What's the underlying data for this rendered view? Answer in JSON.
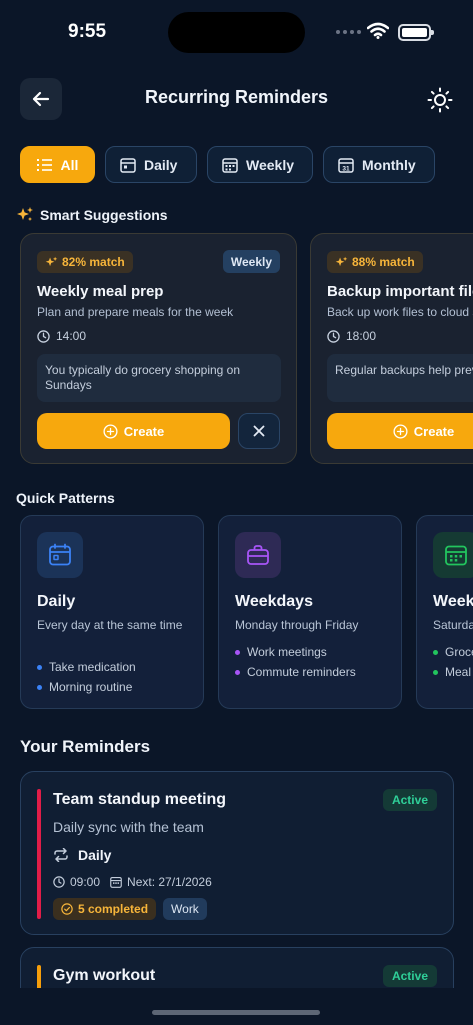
{
  "status_bar": {
    "time": "9:55"
  },
  "header": {
    "title": "Recurring Reminders",
    "back_icon": "arrow-left-icon",
    "theme_icon": "sun-icon"
  },
  "filters": [
    {
      "label": "All",
      "icon": "list-icon",
      "active": true
    },
    {
      "label": "Daily",
      "icon": "calendar-icon",
      "active": false
    },
    {
      "label": "Weekly",
      "icon": "calendar-grid-icon",
      "active": false
    },
    {
      "label": "Monthly",
      "icon": "calendar-31-icon",
      "active": false
    }
  ],
  "suggestions": {
    "heading": "Smart Suggestions",
    "items": [
      {
        "match": "82% match",
        "frequency": "Weekly",
        "title": "Weekly meal prep",
        "description": "Plan and prepare meals for the week",
        "time": "14:00",
        "reason": "You typically do grocery shopping on Sundays",
        "create_label": "Create"
      },
      {
        "match": "88% match",
        "frequency": "",
        "title": "Backup important files",
        "description": "Back up work files to cloud storage",
        "time": "18:00",
        "reason": "Regular backups help prevent data loss",
        "create_label": "Create"
      }
    ]
  },
  "patterns": {
    "heading": "Quick Patterns",
    "items": [
      {
        "title": "Daily",
        "description": "Every day at the same time",
        "examples": [
          "Take medication",
          "Morning routine"
        ],
        "color": "#3b82f6"
      },
      {
        "title": "Weekdays",
        "description": "Monday through Friday",
        "examples": [
          "Work meetings",
          "Commute reminders"
        ],
        "color": "#a855f7"
      },
      {
        "title": "Weekends",
        "description": "Saturday and Sunday",
        "examples": [
          "Grocery shopping",
          "Meal prep"
        ],
        "color": "#22c55e"
      }
    ]
  },
  "reminders": {
    "heading": "Your Reminders",
    "items": [
      {
        "title": "Team standup meeting",
        "status": "Active",
        "description": "Daily sync with the team",
        "frequency": "Daily",
        "time": "09:00",
        "next": "Next: 27/1/2026",
        "completed": "5 completed",
        "category": "Work",
        "accent": "#e11d48"
      },
      {
        "title": "Gym workout",
        "status": "Active",
        "accent": "#f59e0b"
      }
    ]
  }
}
